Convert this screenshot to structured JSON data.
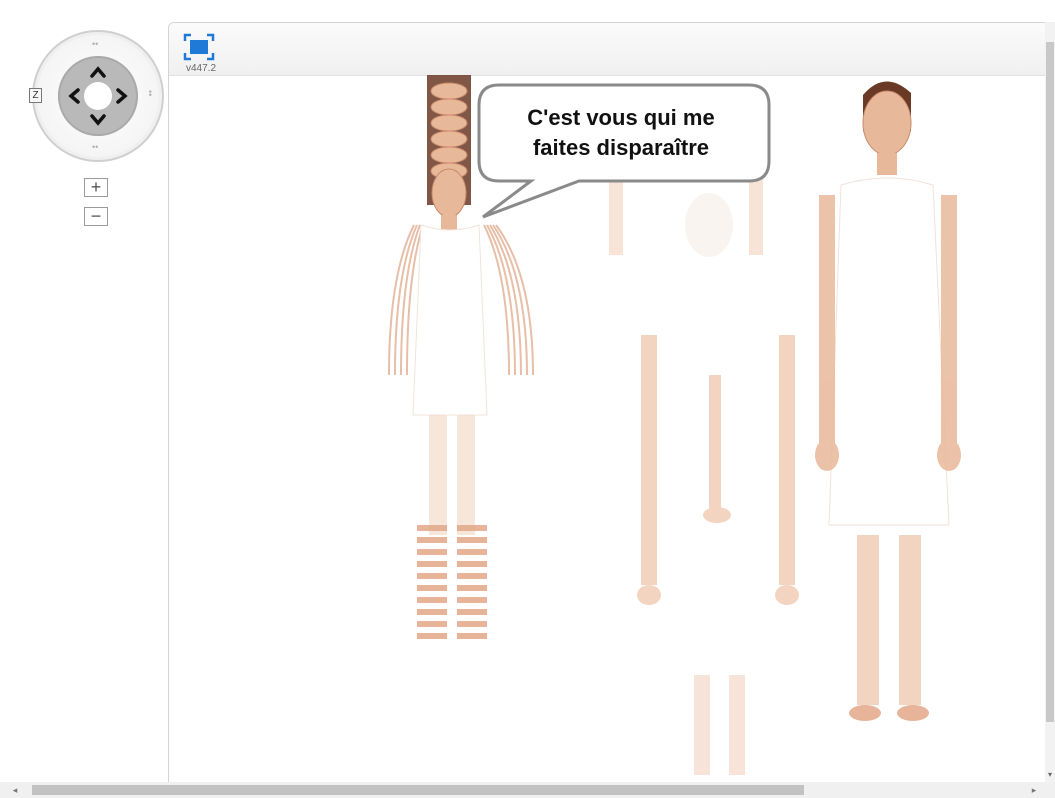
{
  "navigation": {
    "zoom_letter": "Z",
    "zoom_in_label": "+",
    "zoom_out_label": "−"
  },
  "toolbar": {
    "fullscreen_icon": "fullscreen-icon",
    "version": "v447.2"
  },
  "speech_bubble": {
    "line1": "C'est vous qui me",
    "line2": "faites disparaître"
  },
  "colors": {
    "accent": "#1e7ad6",
    "skin": "#e8b89a",
    "skin_shadow": "#c98a6a",
    "hair": "#6a3a26"
  },
  "scrollbars": {
    "left_arrow": "◂",
    "right_arrow": "▸",
    "down_arrow": "▾"
  }
}
